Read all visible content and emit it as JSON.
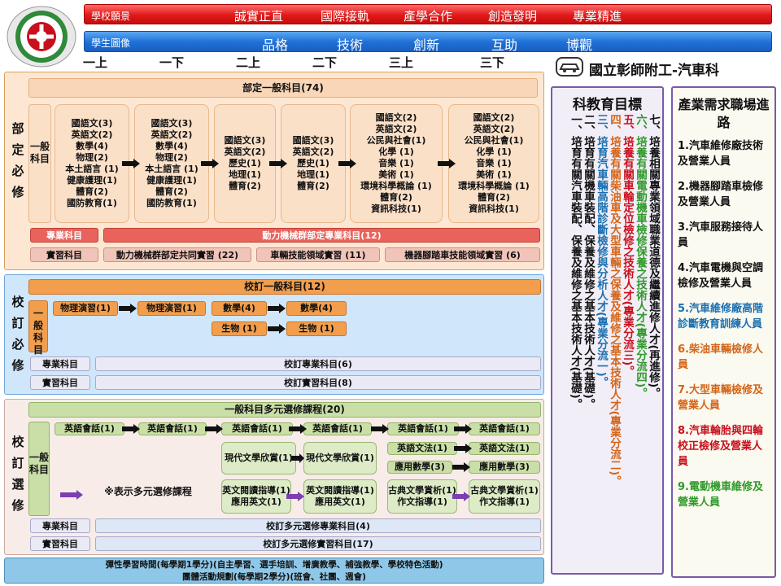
{
  "vision": {
    "label": "學校願景",
    "items": [
      "誠實正直",
      "國際接軌",
      "產學合作",
      "創造發明",
      "專業精進"
    ]
  },
  "student": {
    "label": "學生圖像",
    "items": [
      "品格",
      "技術",
      "創新",
      "互助",
      "博觀"
    ]
  },
  "semesters": [
    "一上",
    "一下",
    "二上",
    "二下",
    "三上",
    "三下"
  ],
  "school": "國立彰師附工-汽車科",
  "sec1": {
    "side": "部定必修",
    "header": "部定一般科目(74)",
    "gen_label": "一般科目",
    "s1": [
      "國語文(3)",
      "英語文(2)",
      "數學(4)",
      "物理(2)",
      "本土語言 (1)",
      "健康護理(1)",
      "體育(2)",
      "國防教育(1)"
    ],
    "s2": [
      "國語文(3)",
      "英語文(2)",
      "數學(4)",
      "物理(2)",
      "本土語言 (1)",
      "健康護理(1)",
      "體育(2)",
      "國防教育(1)"
    ],
    "s3": [
      "國語文(3)",
      "英語文(2)",
      "歷史(1)",
      "地理(1)",
      "體育(2)"
    ],
    "s4": [
      "國語文(3)",
      "英語文(2)",
      "歷史(1)",
      "地理(1)",
      "體育(2)"
    ],
    "s5": [
      "國語文(2)",
      "英語文(2)",
      "公民與社會(1)",
      "化學 (1)",
      "音樂 (1)",
      "美術 (1)",
      "環境科學概論 (1)",
      "體育(2)",
      "資訊科技(1)"
    ],
    "s6": [
      "國語文(2)",
      "英語文(2)",
      "公民與社會(1)",
      "化學 (1)",
      "音樂 (1)",
      "美術 (1)",
      "環境科學概論 (1)",
      "體育(2)",
      "資訊科技(1)"
    ],
    "pro_label": "專業科目",
    "pro": "動力機械群部定專業科目(12)",
    "prac_label": "實習科目",
    "prac": [
      "動力機械群部定共同實習 (22)",
      "車輛技能領域實習 (11)",
      "機器腳踏車技能領域實習 (6)"
    ]
  },
  "sec2": {
    "side": "校訂必修",
    "header": "校訂一般科目(12)",
    "gen_label": "一般科目",
    "row1": [
      "物理演習(1)",
      "物理演習(1)",
      "數學(4)",
      "數學(4)"
    ],
    "row2": [
      "生物 (1)",
      "生物 (1)"
    ],
    "pro_label": "專業科目",
    "pro": "校訂專業科目(6)",
    "prac_label": "實習科目",
    "prac": "校訂實習科目(8)"
  },
  "sec3": {
    "side": "校訂選修",
    "header": "一般科目多元選修課程(20)",
    "gen_label": "一般科目",
    "eng": [
      "英語會話(1)",
      "英語會話(1)",
      "英語會話(1)",
      "英語會話(1)",
      "英語會話(1)",
      "英語會話(1)"
    ],
    "lit": [
      "現代文學欣賞(1)",
      "現代文學欣賞(1)"
    ],
    "gram": [
      "英語文法(1)",
      "英語文法(1)"
    ],
    "math": [
      "應用數學(3)",
      "應用數學(3)"
    ],
    "read": [
      "英文閱讀指導(1)",
      "應用英文(1)",
      "英文閱讀指導(1)",
      "應用英文(1)"
    ],
    "classic": [
      "古典文學賞析(1)",
      "作文指導(1)",
      "古典文學賞析(1)",
      "作文指導(1)"
    ],
    "note": "※表示多元選修課程",
    "pro_label": "專業科目",
    "pro": "校訂多元選修專業科目(4)",
    "prac_label": "實習科目",
    "prac": "校訂多元選修實習科目(17)"
  },
  "footer": [
    "彈性學習時間(每學期1學分)(自主學習、選手培訓、增廣教學、補強教學、學校特色活動)",
    "團體活動規劃(每學期2學分)(班會、社團、週會)"
  ],
  "goals": {
    "title": "科教育目標",
    "items": [
      "一、培育有關汽車裝配、保養及維修之基本技術人才(基礎)。",
      "二、培育有關機車裝配、保養及維修之基本技術人才(基礎)。",
      "三、培育汽車輛高階診斷檢修與分析人才(專業分流一)。",
      "四、培養有關柴油車及大型車輛之保養及維修之基本技術人才(專業分流二)。",
      "五、培養有關車輪定位檢修之技術人才(專業分流三)。",
      "六、培養有關電動機車檢修保養之技術人才(專業分流四)。",
      "七、培養相關專業領域職業道德及繼續進修人才(再進修)。"
    ],
    "colors": [
      "#111111",
      "#111111",
      "#1a6fb0",
      "#d4651a",
      "#c8101c",
      "#2f9a2a",
      "#111111"
    ]
  },
  "careers": {
    "title": "產業需求職場進路",
    "items": [
      "1.汽車維修廠技術及營業人員",
      "2.機器腳踏車檢修及營業人員",
      "3.汽車服務接待人員",
      "4.汽車電機與空調檢修及營業人員",
      "5.汽車維修廠高階診斷教育訓練人員",
      "6.柴油車輛檢修人員",
      "7.大型車輛檢修及營業人員",
      "8.汽車輪胎與四輪校正檢修及營業人員",
      "9.電動機車維修及營業人員"
    ],
    "colors": [
      "#111111",
      "#111111",
      "#111111",
      "#111111",
      "#1a6fb0",
      "#d4651a",
      "#d4651a",
      "#c8101c",
      "#2f9a2a"
    ]
  }
}
